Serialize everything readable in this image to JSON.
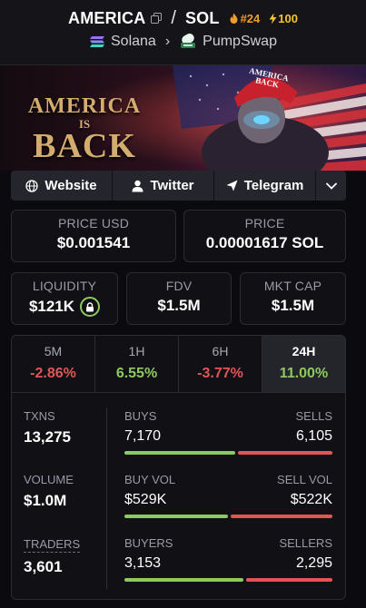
{
  "pair": {
    "base": "AMERICA",
    "quote": "SOL",
    "separator": "/",
    "rank": "#24",
    "boost": "100",
    "chain": "Solana",
    "dex": "PumpSwap"
  },
  "banner": {
    "line1": "AMERICA",
    "line2": "IS",
    "line3": "BACK",
    "cap_line1": "AMERICA",
    "cap_line2": "BACK"
  },
  "links": {
    "website": "Website",
    "twitter": "Twitter",
    "telegram": "Telegram"
  },
  "prices": {
    "price_usd_label": "PRICE USD",
    "price_usd": "$0.001541",
    "price_label": "PRICE",
    "price_sol": "0.00001617 SOL"
  },
  "metrics": {
    "liquidity_label": "LIQUIDITY",
    "liquidity": "$121K",
    "fdv_label": "FDV",
    "fdv": "$1.5M",
    "mktcap_label": "MKT CAP",
    "mktcap": "$1.5M"
  },
  "timeframes": [
    {
      "label": "5M",
      "value": "-2.86%",
      "color": "#e25555"
    },
    {
      "label": "1H",
      "value": "6.55%",
      "color": "#8dc95f"
    },
    {
      "label": "6H",
      "value": "-3.77%",
      "color": "#e25555"
    },
    {
      "label": "24H",
      "value": "11.00%",
      "color": "#8dc95f"
    }
  ],
  "stats": {
    "txns_label": "TXNS",
    "txns": "13,275",
    "volume_label": "VOLUME",
    "volume": "$1.0M",
    "traders_label": "TRADERS",
    "traders": "3,601",
    "buys_label": "BUYS",
    "buys": "7,170",
    "sells_label": "SELLS",
    "sells": "6,105",
    "buys_fraction": 0.54,
    "buyvol_label": "BUY VOL",
    "buyvol": "$529K",
    "sellvol_label": "SELL VOL",
    "sellvol": "$522K",
    "buyvol_fraction": 0.503,
    "buyers_label": "BUYERS",
    "buyers": "3,153",
    "sellers_label": "SELLERS",
    "sellers": "2,295",
    "buyers_fraction": 0.579
  },
  "colors": {
    "positive": "#8dc95f",
    "negative": "#e25555",
    "rank": "#f29b2e",
    "boost": "#f5c531"
  },
  "icons": {
    "copy": "copy-icon",
    "rank": "fire-icon",
    "boost": "lightning-icon",
    "chain": "solana-icon",
    "dex": "pumpswap-icon",
    "website": "globe-icon",
    "twitter": "user-icon",
    "telegram": "send-icon",
    "more": "chevron-down-icon",
    "lock": "lock-icon"
  }
}
